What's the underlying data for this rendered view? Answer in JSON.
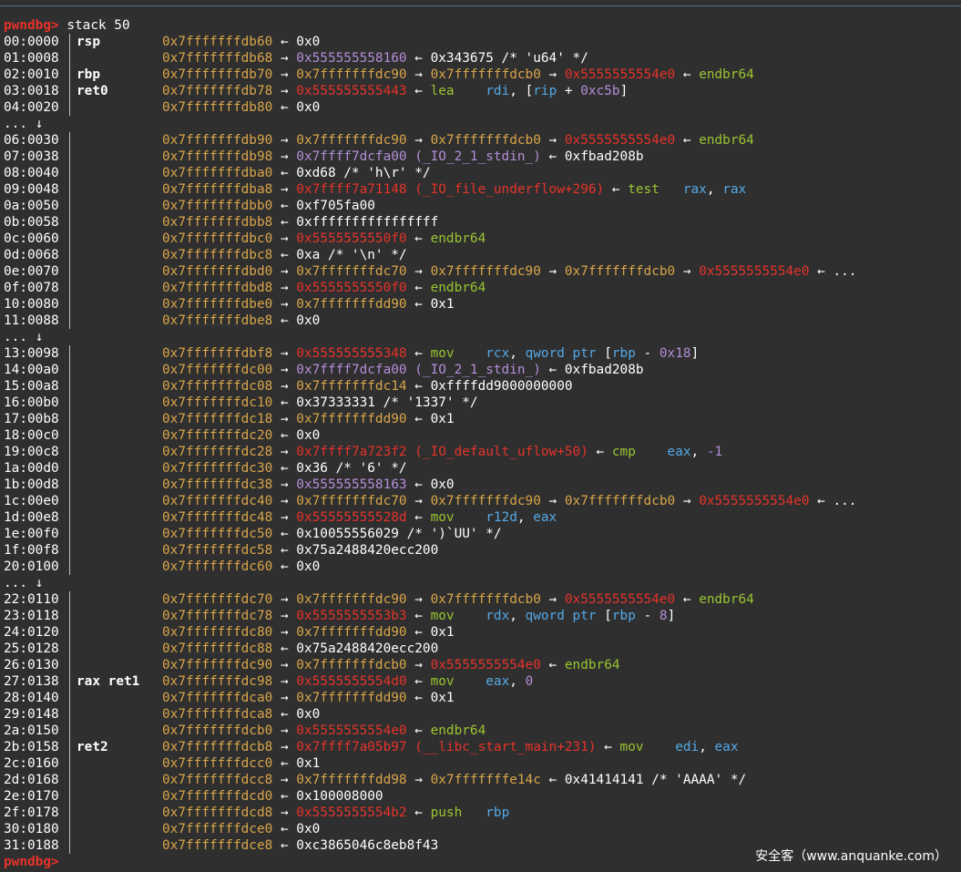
{
  "prompt": "pwndbg>",
  "command": "stack 50",
  "watermark": "安全客（www.anquanke.com）",
  "lines": [
    {
      "kind": "row",
      "idx": "00:0000",
      "reg": "rsp",
      "tokens": [
        [
          "0x7fffffffdb60",
          "y"
        ],
        [
          " ← 0x0",
          "w"
        ]
      ]
    },
    {
      "kind": "row",
      "idx": "01:0008",
      "reg": "",
      "tokens": [
        [
          "0x7fffffffdb68",
          "y"
        ],
        [
          " → ",
          "w"
        ],
        [
          "0x555555558160",
          "p"
        ],
        [
          " ← 0x343675 /* 'u64' */",
          "w"
        ]
      ]
    },
    {
      "kind": "row",
      "idx": "02:0010",
      "reg": "rbp",
      "tokens": [
        [
          "0x7fffffffdb70",
          "y"
        ],
        [
          " → ",
          "w"
        ],
        [
          "0x7fffffffdc90",
          "y"
        ],
        [
          " → ",
          "w"
        ],
        [
          "0x7fffffffdcb0",
          "y"
        ],
        [
          " → ",
          "w"
        ],
        [
          "0x5555555554e0",
          "r"
        ],
        [
          " ← ",
          "w"
        ],
        [
          "endbr64",
          "g"
        ]
      ]
    },
    {
      "kind": "row",
      "idx": "03:0018",
      "reg": "ret0",
      "tokens": [
        [
          "0x7fffffffdb78",
          "y"
        ],
        [
          " → ",
          "w"
        ],
        [
          "0x555555555443",
          "r"
        ],
        [
          " ← ",
          "w"
        ],
        [
          "lea",
          "g"
        ],
        [
          "    ",
          "w"
        ],
        [
          "rdi",
          "b"
        ],
        [
          ", [",
          "w"
        ],
        [
          "rip",
          "b"
        ],
        [
          " + ",
          "w"
        ],
        [
          "0xc5b",
          "p"
        ],
        [
          "]",
          "w"
        ]
      ]
    },
    {
      "kind": "row",
      "idx": "04:0020",
      "reg": "",
      "tokens": [
        [
          "0x7fffffffdb80",
          "y"
        ],
        [
          " ← 0x0",
          "w"
        ]
      ]
    },
    {
      "kind": "skip",
      "text": "... ↓"
    },
    {
      "kind": "row",
      "idx": "06:0030",
      "reg": "",
      "tokens": [
        [
          "0x7fffffffdb90",
          "y"
        ],
        [
          " → ",
          "w"
        ],
        [
          "0x7fffffffdc90",
          "y"
        ],
        [
          " → ",
          "w"
        ],
        [
          "0x7fffffffdcb0",
          "y"
        ],
        [
          " → ",
          "w"
        ],
        [
          "0x5555555554e0",
          "r"
        ],
        [
          " ← ",
          "w"
        ],
        [
          "endbr64",
          "g"
        ]
      ]
    },
    {
      "kind": "row",
      "idx": "07:0038",
      "reg": "",
      "tokens": [
        [
          "0x7fffffffdb98",
          "y"
        ],
        [
          " → ",
          "w"
        ],
        [
          "0x7ffff7dcfa00 (_IO_2_1_stdin_)",
          "p"
        ],
        [
          " ← 0xfbad208b",
          "w"
        ]
      ]
    },
    {
      "kind": "row",
      "idx": "08:0040",
      "reg": "",
      "tokens": [
        [
          "0x7fffffffdba0",
          "y"
        ],
        [
          " ← 0xd68 /* 'h\\r' */",
          "w"
        ]
      ]
    },
    {
      "kind": "row",
      "idx": "09:0048",
      "reg": "",
      "tokens": [
        [
          "0x7fffffffdba8",
          "y"
        ],
        [
          " → ",
          "w"
        ],
        [
          "0x7ffff7a71148 (_IO_file_underflow+296)",
          "r"
        ],
        [
          " ← ",
          "w"
        ],
        [
          "test",
          "g"
        ],
        [
          "   ",
          "w"
        ],
        [
          "rax",
          "b"
        ],
        [
          ", ",
          "w"
        ],
        [
          "rax",
          "b"
        ]
      ]
    },
    {
      "kind": "row",
      "idx": "0a:0050",
      "reg": "",
      "tokens": [
        [
          "0x7fffffffdbb0",
          "y"
        ],
        [
          " ← 0xf705fa00",
          "w"
        ]
      ]
    },
    {
      "kind": "row",
      "idx": "0b:0058",
      "reg": "",
      "tokens": [
        [
          "0x7fffffffdbb8",
          "y"
        ],
        [
          " ← 0xffffffffffffffff",
          "w"
        ]
      ]
    },
    {
      "kind": "row",
      "idx": "0c:0060",
      "reg": "",
      "tokens": [
        [
          "0x7fffffffdbc0",
          "y"
        ],
        [
          " → ",
          "w"
        ],
        [
          "0x5555555550f0",
          "r"
        ],
        [
          " ← ",
          "w"
        ],
        [
          "endbr64",
          "g"
        ]
      ]
    },
    {
      "kind": "row",
      "idx": "0d:0068",
      "reg": "",
      "tokens": [
        [
          "0x7fffffffdbc8",
          "y"
        ],
        [
          " ← 0xa /* '\\n' */",
          "w"
        ]
      ]
    },
    {
      "kind": "row",
      "idx": "0e:0070",
      "reg": "",
      "tokens": [
        [
          "0x7fffffffdbd0",
          "y"
        ],
        [
          " → ",
          "w"
        ],
        [
          "0x7fffffffdc70",
          "y"
        ],
        [
          " → ",
          "w"
        ],
        [
          "0x7fffffffdc90",
          "y"
        ],
        [
          " → ",
          "w"
        ],
        [
          "0x7fffffffdcb0",
          "y"
        ],
        [
          " → ",
          "w"
        ],
        [
          "0x5555555554e0",
          "r"
        ],
        [
          " ← ...",
          "w"
        ]
      ]
    },
    {
      "kind": "row",
      "idx": "0f:0078",
      "reg": "",
      "tokens": [
        [
          "0x7fffffffdbd8",
          "y"
        ],
        [
          " → ",
          "w"
        ],
        [
          "0x5555555550f0",
          "r"
        ],
        [
          " ← ",
          "w"
        ],
        [
          "endbr64",
          "g"
        ]
      ]
    },
    {
      "kind": "row",
      "idx": "10:0080",
      "reg": "",
      "tokens": [
        [
          "0x7fffffffdbe0",
          "y"
        ],
        [
          " → ",
          "w"
        ],
        [
          "0x7fffffffdd90",
          "y"
        ],
        [
          " ← 0x1",
          "w"
        ]
      ]
    },
    {
      "kind": "row",
      "idx": "11:0088",
      "reg": "",
      "tokens": [
        [
          "0x7fffffffdbe8",
          "y"
        ],
        [
          " ← 0x0",
          "w"
        ]
      ]
    },
    {
      "kind": "skip",
      "text": "... ↓"
    },
    {
      "kind": "row",
      "idx": "13:0098",
      "reg": "",
      "tokens": [
        [
          "0x7fffffffdbf8",
          "y"
        ],
        [
          " → ",
          "w"
        ],
        [
          "0x555555555348",
          "r"
        ],
        [
          " ← ",
          "w"
        ],
        [
          "mov",
          "g"
        ],
        [
          "    ",
          "w"
        ],
        [
          "rcx",
          "b"
        ],
        [
          ", ",
          "w"
        ],
        [
          "qword ptr",
          "b"
        ],
        [
          " [",
          "w"
        ],
        [
          "rbp",
          "b"
        ],
        [
          " - ",
          "w"
        ],
        [
          "0x18",
          "p"
        ],
        [
          "]",
          "w"
        ]
      ]
    },
    {
      "kind": "row",
      "idx": "14:00a0",
      "reg": "",
      "tokens": [
        [
          "0x7fffffffdc00",
          "y"
        ],
        [
          " → ",
          "w"
        ],
        [
          "0x7ffff7dcfa00 (_IO_2_1_stdin_)",
          "p"
        ],
        [
          " ← 0xfbad208b",
          "w"
        ]
      ]
    },
    {
      "kind": "row",
      "idx": "15:00a8",
      "reg": "",
      "tokens": [
        [
          "0x7fffffffdc08",
          "y"
        ],
        [
          " → ",
          "w"
        ],
        [
          "0x7fffffffdc14",
          "y"
        ],
        [
          " ← 0xffffdd9000000000",
          "w"
        ]
      ]
    },
    {
      "kind": "row",
      "idx": "16:00b0",
      "reg": "",
      "tokens": [
        [
          "0x7fffffffdc10",
          "y"
        ],
        [
          " ← 0x37333331 /* '1337' */",
          "w"
        ]
      ]
    },
    {
      "kind": "row",
      "idx": "17:00b8",
      "reg": "",
      "tokens": [
        [
          "0x7fffffffdc18",
          "y"
        ],
        [
          " → ",
          "w"
        ],
        [
          "0x7fffffffdd90",
          "y"
        ],
        [
          " ← 0x1",
          "w"
        ]
      ]
    },
    {
      "kind": "row",
      "idx": "18:00c0",
      "reg": "",
      "tokens": [
        [
          "0x7fffffffdc20",
          "y"
        ],
        [
          " ← 0x0",
          "w"
        ]
      ]
    },
    {
      "kind": "row",
      "idx": "19:00c8",
      "reg": "",
      "tokens": [
        [
          "0x7fffffffdc28",
          "y"
        ],
        [
          " → ",
          "w"
        ],
        [
          "0x7ffff7a723f2 (_IO_default_uflow+50)",
          "r"
        ],
        [
          " ← ",
          "w"
        ],
        [
          "cmp",
          "g"
        ],
        [
          "    ",
          "w"
        ],
        [
          "eax",
          "b"
        ],
        [
          ", ",
          "w"
        ],
        [
          "-1",
          "p"
        ]
      ]
    },
    {
      "kind": "row",
      "idx": "1a:00d0",
      "reg": "",
      "tokens": [
        [
          "0x7fffffffdc30",
          "y"
        ],
        [
          " ← 0x36 /* '6' */",
          "w"
        ]
      ]
    },
    {
      "kind": "row",
      "idx": "1b:00d8",
      "reg": "",
      "tokens": [
        [
          "0x7fffffffdc38",
          "y"
        ],
        [
          " → ",
          "w"
        ],
        [
          "0x555555558163",
          "p"
        ],
        [
          " ← 0x0",
          "w"
        ]
      ]
    },
    {
      "kind": "row",
      "idx": "1c:00e0",
      "reg": "",
      "tokens": [
        [
          "0x7fffffffdc40",
          "y"
        ],
        [
          " → ",
          "w"
        ],
        [
          "0x7fffffffdc70",
          "y"
        ],
        [
          " → ",
          "w"
        ],
        [
          "0x7fffffffdc90",
          "y"
        ],
        [
          " → ",
          "w"
        ],
        [
          "0x7fffffffdcb0",
          "y"
        ],
        [
          " → ",
          "w"
        ],
        [
          "0x5555555554e0",
          "r"
        ],
        [
          " ← ...",
          "w"
        ]
      ]
    },
    {
      "kind": "row",
      "idx": "1d:00e8",
      "reg": "",
      "tokens": [
        [
          "0x7fffffffdc48",
          "y"
        ],
        [
          " → ",
          "w"
        ],
        [
          "0x55555555528d",
          "r"
        ],
        [
          " ← ",
          "w"
        ],
        [
          "mov",
          "g"
        ],
        [
          "    ",
          "w"
        ],
        [
          "r12d",
          "b"
        ],
        [
          ", ",
          "w"
        ],
        [
          "eax",
          "b"
        ]
      ]
    },
    {
      "kind": "row",
      "idx": "1e:00f0",
      "reg": "",
      "tokens": [
        [
          "0x7fffffffdc50",
          "y"
        ],
        [
          " ← 0x10055556029 /* ')`UU' */",
          "w"
        ]
      ]
    },
    {
      "kind": "row",
      "idx": "1f:00f8",
      "reg": "",
      "tokens": [
        [
          "0x7fffffffdc58",
          "y"
        ],
        [
          " ← 0x75a2488420ecc200",
          "w"
        ]
      ]
    },
    {
      "kind": "row",
      "idx": "20:0100",
      "reg": "",
      "tokens": [
        [
          "0x7fffffffdc60",
          "y"
        ],
        [
          " ← 0x0",
          "w"
        ]
      ]
    },
    {
      "kind": "skip",
      "text": "... ↓"
    },
    {
      "kind": "row",
      "idx": "22:0110",
      "reg": "",
      "tokens": [
        [
          "0x7fffffffdc70",
          "y"
        ],
        [
          " → ",
          "w"
        ],
        [
          "0x7fffffffdc90",
          "y"
        ],
        [
          " → ",
          "w"
        ],
        [
          "0x7fffffffdcb0",
          "y"
        ],
        [
          " → ",
          "w"
        ],
        [
          "0x5555555554e0",
          "r"
        ],
        [
          " ← ",
          "w"
        ],
        [
          "endbr64",
          "g"
        ]
      ]
    },
    {
      "kind": "row",
      "idx": "23:0118",
      "reg": "",
      "tokens": [
        [
          "0x7fffffffdc78",
          "y"
        ],
        [
          " → ",
          "w"
        ],
        [
          "0x5555555553b3",
          "r"
        ],
        [
          " ← ",
          "w"
        ],
        [
          "mov",
          "g"
        ],
        [
          "    ",
          "w"
        ],
        [
          "rdx",
          "b"
        ],
        [
          ", ",
          "w"
        ],
        [
          "qword ptr",
          "b"
        ],
        [
          " [",
          "w"
        ],
        [
          "rbp",
          "b"
        ],
        [
          " - ",
          "w"
        ],
        [
          "8",
          "p"
        ],
        [
          "]",
          "w"
        ]
      ]
    },
    {
      "kind": "row",
      "idx": "24:0120",
      "reg": "",
      "tokens": [
        [
          "0x7fffffffdc80",
          "y"
        ],
        [
          " → ",
          "w"
        ],
        [
          "0x7fffffffdd90",
          "y"
        ],
        [
          " ← 0x1",
          "w"
        ]
      ]
    },
    {
      "kind": "row",
      "idx": "25:0128",
      "reg": "",
      "tokens": [
        [
          "0x7fffffffdc88",
          "y"
        ],
        [
          " ← 0x75a2488420ecc200",
          "w"
        ]
      ]
    },
    {
      "kind": "row",
      "idx": "26:0130",
      "reg": "",
      "tokens": [
        [
          "0x7fffffffdc90",
          "y"
        ],
        [
          " → ",
          "w"
        ],
        [
          "0x7fffffffdcb0",
          "y"
        ],
        [
          " → ",
          "w"
        ],
        [
          "0x5555555554e0",
          "r"
        ],
        [
          " ← ",
          "w"
        ],
        [
          "endbr64",
          "g"
        ]
      ]
    },
    {
      "kind": "row",
      "idx": "27:0138",
      "reg": "rax ret1",
      "tokens": [
        [
          "0x7fffffffdc98",
          "y"
        ],
        [
          " → ",
          "w"
        ],
        [
          "0x5555555554d0",
          "r"
        ],
        [
          " ← ",
          "w"
        ],
        [
          "mov",
          "g"
        ],
        [
          "    ",
          "w"
        ],
        [
          "eax",
          "b"
        ],
        [
          ", ",
          "w"
        ],
        [
          "0",
          "p"
        ]
      ]
    },
    {
      "kind": "row",
      "idx": "28:0140",
      "reg": "",
      "tokens": [
        [
          "0x7fffffffdca0",
          "y"
        ],
        [
          " → ",
          "w"
        ],
        [
          "0x7fffffffdd90",
          "y"
        ],
        [
          " ← 0x1",
          "w"
        ]
      ]
    },
    {
      "kind": "row",
      "idx": "29:0148",
      "reg": "",
      "tokens": [
        [
          "0x7fffffffdca8",
          "y"
        ],
        [
          " ← 0x0",
          "w"
        ]
      ]
    },
    {
      "kind": "row",
      "idx": "2a:0150",
      "reg": "",
      "tokens": [
        [
          "0x7fffffffdcb0",
          "y"
        ],
        [
          " → ",
          "w"
        ],
        [
          "0x5555555554e0",
          "r"
        ],
        [
          " ← ",
          "w"
        ],
        [
          "endbr64",
          "g"
        ]
      ]
    },
    {
      "kind": "row",
      "idx": "2b:0158",
      "reg": "ret2",
      "tokens": [
        [
          "0x7fffffffdcb8",
          "y"
        ],
        [
          " → ",
          "w"
        ],
        [
          "0x7ffff7a05b97 (__libc_start_main+231)",
          "r"
        ],
        [
          " ← ",
          "w"
        ],
        [
          "mov",
          "g"
        ],
        [
          "    ",
          "w"
        ],
        [
          "edi",
          "b"
        ],
        [
          ", ",
          "w"
        ],
        [
          "eax",
          "b"
        ]
      ]
    },
    {
      "kind": "row",
      "idx": "2c:0160",
      "reg": "",
      "tokens": [
        [
          "0x7fffffffdcc0",
          "y"
        ],
        [
          " ← 0x1",
          "w"
        ]
      ]
    },
    {
      "kind": "row",
      "idx": "2d:0168",
      "reg": "",
      "tokens": [
        [
          "0x7fffffffdcc8",
          "y"
        ],
        [
          " → ",
          "w"
        ],
        [
          "0x7fffffffdd98",
          "y"
        ],
        [
          " → ",
          "w"
        ],
        [
          "0x7fffffffe14c",
          "y"
        ],
        [
          " ← 0x41414141 /* 'AAAA' */",
          "w"
        ]
      ]
    },
    {
      "kind": "row",
      "idx": "2e:0170",
      "reg": "",
      "tokens": [
        [
          "0x7fffffffdcd0",
          "y"
        ],
        [
          " ← 0x100008000",
          "w"
        ]
      ]
    },
    {
      "kind": "row",
      "idx": "2f:0178",
      "reg": "",
      "tokens": [
        [
          "0x7fffffffdcd8",
          "y"
        ],
        [
          " → ",
          "w"
        ],
        [
          "0x5555555554b2",
          "r"
        ],
        [
          " ← ",
          "w"
        ],
        [
          "push",
          "g"
        ],
        [
          "   ",
          "w"
        ],
        [
          "rbp",
          "b"
        ]
      ]
    },
    {
      "kind": "row",
      "idx": "30:0180",
      "reg": "",
      "tokens": [
        [
          "0x7fffffffdce0",
          "y"
        ],
        [
          " ← 0x0",
          "w"
        ]
      ]
    },
    {
      "kind": "row",
      "idx": "31:0188",
      "reg": "",
      "tokens": [
        [
          "0x7fffffffdce8",
          "y"
        ],
        [
          " ← 0xc3865046c8eb8f43",
          "w"
        ]
      ]
    }
  ]
}
